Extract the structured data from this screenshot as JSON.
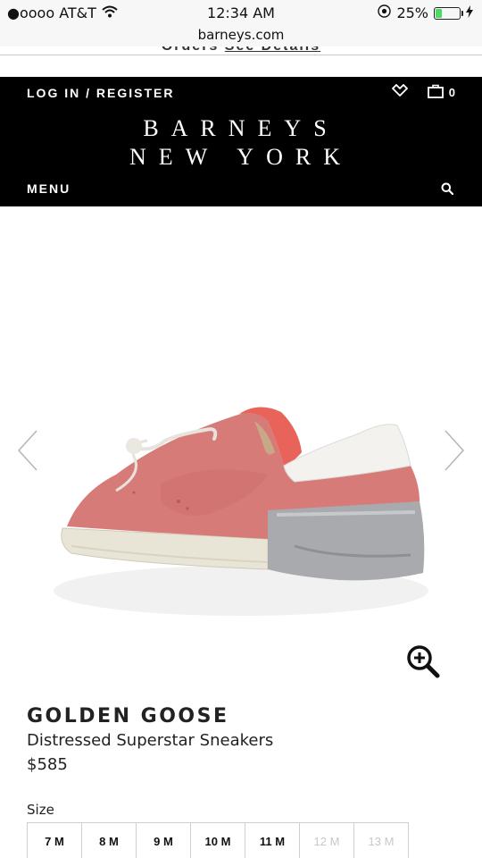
{
  "status_bar": {
    "carrier": "●oooo AT&T",
    "time": "12:34 AM",
    "battery_percent": "25%",
    "battery_level": 0.25
  },
  "browser": {
    "url": "barneys.com"
  },
  "top_strip": {
    "orders_text": "Orders",
    "see_details": "See Details"
  },
  "header": {
    "login_label": "LOG IN / REGISTER",
    "bag_count": "0",
    "logo_line1": "BARNEYS",
    "logo_line2": "NEW YORK",
    "menu_label": "MENU"
  },
  "product": {
    "brand": "GOLDEN GOOSE",
    "name": "Distressed Superstar Sneakers",
    "price": "$585",
    "size_label": "Size",
    "sizes": [
      {
        "label": "7 M",
        "available": true
      },
      {
        "label": "8 M",
        "available": true
      },
      {
        "label": "9 M",
        "available": true
      },
      {
        "label": "10 M",
        "available": true
      },
      {
        "label": "11 M",
        "available": true
      },
      {
        "label": "12 M",
        "available": false
      },
      {
        "label": "13 M",
        "available": false
      }
    ]
  },
  "colors": {
    "header_bg": "#000000",
    "battery_green": "#4cd964",
    "shoe_pink": "#d77b78",
    "tape_silver": "#a9aaad"
  },
  "icons": [
    "wifi-icon",
    "location-icon",
    "charging-icon",
    "heart-icon",
    "bag-icon",
    "search-icon",
    "chevron-left-icon",
    "chevron-right-icon",
    "zoom-in-icon"
  ]
}
